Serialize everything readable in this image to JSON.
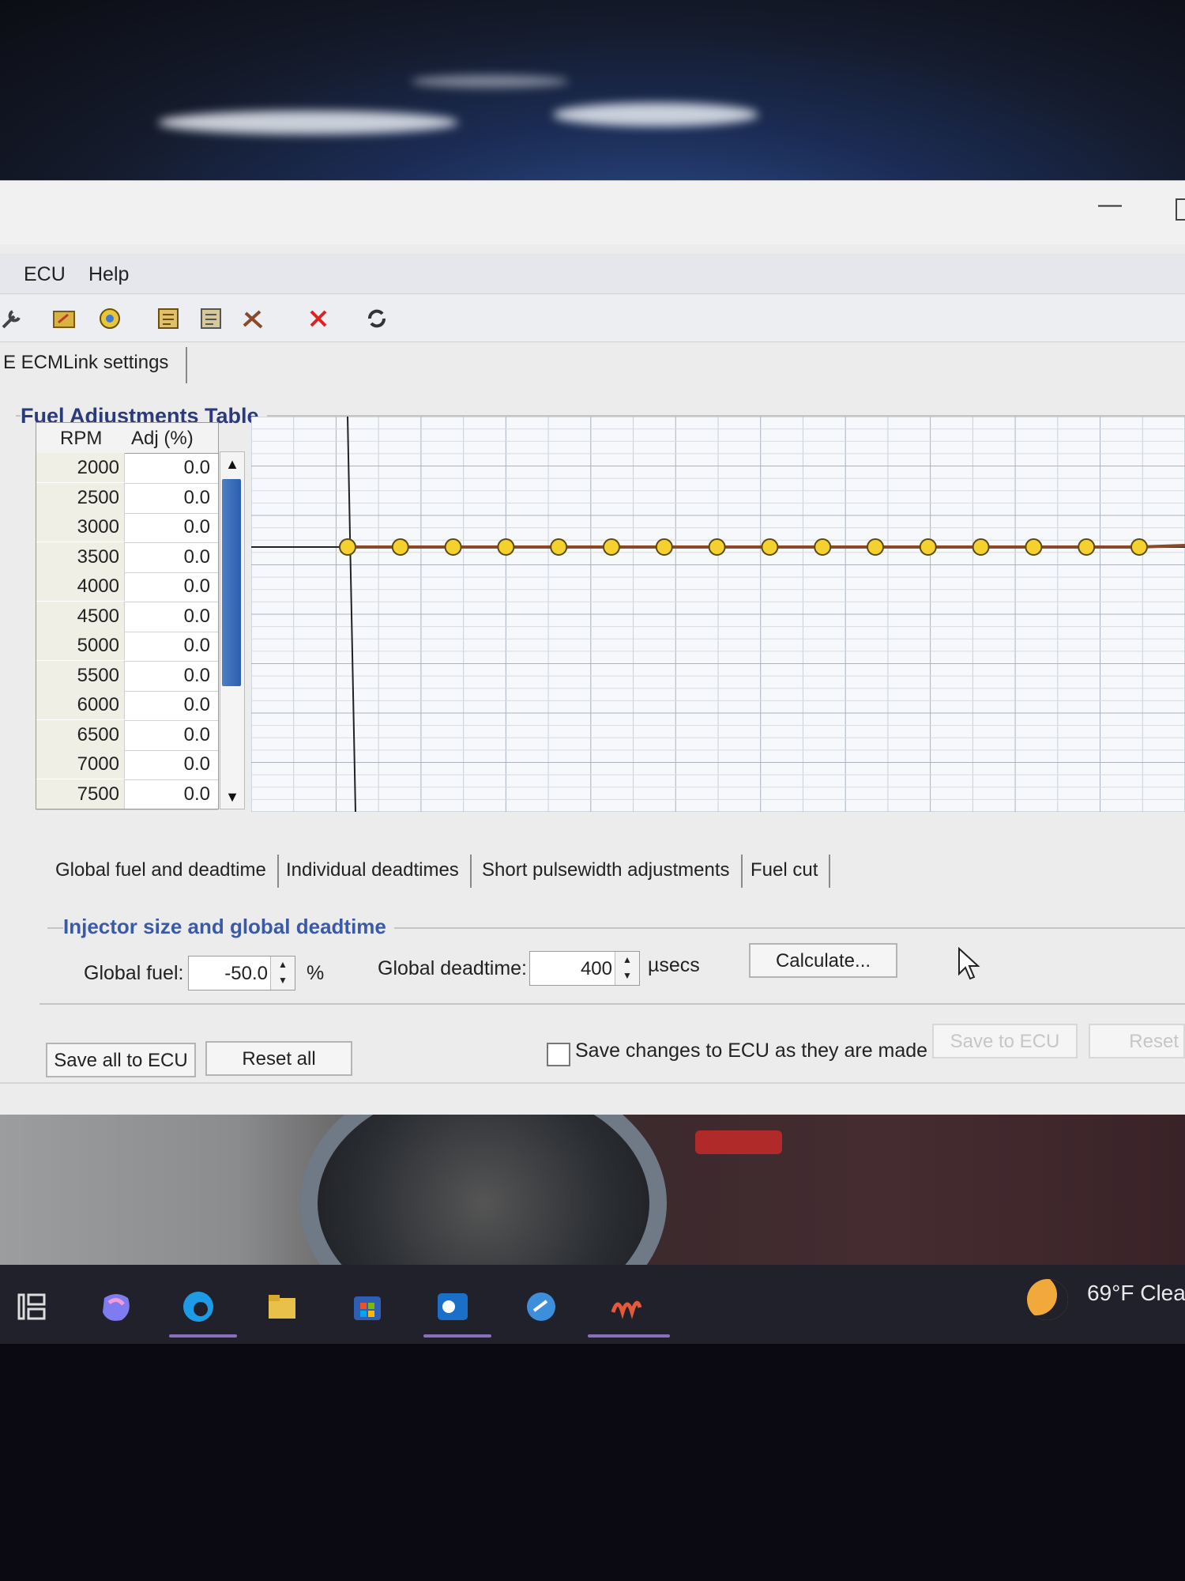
{
  "window": {
    "menu": [
      "ECU",
      "Help"
    ],
    "page_tab": "E ECMLink settings"
  },
  "fuel_table": {
    "title": "Fuel Adjustments Table",
    "columns": [
      "RPM",
      "Adj (%)"
    ],
    "rows": [
      [
        "2000",
        "0.0"
      ],
      [
        "2500",
        "0.0"
      ],
      [
        "3000",
        "0.0"
      ],
      [
        "3500",
        "0.0"
      ],
      [
        "4000",
        "0.0"
      ],
      [
        "4500",
        "0.0"
      ],
      [
        "5000",
        "0.0"
      ],
      [
        "5500",
        "0.0"
      ],
      [
        "6000",
        "0.0"
      ],
      [
        "6500",
        "0.0"
      ],
      [
        "7000",
        "0.0"
      ],
      [
        "7500",
        "0.0"
      ]
    ]
  },
  "chart_data": {
    "type": "line",
    "x": [
      2000,
      2500,
      3000,
      3500,
      4000,
      4500,
      5000,
      5500,
      6000,
      6500,
      7000,
      7500,
      8000,
      8500,
      9000,
      9500
    ],
    "series": [
      {
        "values": [
          0,
          0,
          0,
          0,
          0,
          0,
          0,
          0,
          0,
          0,
          0,
          0,
          0,
          0,
          0,
          0
        ]
      }
    ],
    "grid": true,
    "line_color": "#8a4a2a",
    "marker_color": "#f5d130"
  },
  "sub_tabs": [
    "Global fuel and deadtime",
    "Individual deadtimes",
    "Short pulsewidth adjustments",
    "Fuel cut"
  ],
  "injector": {
    "title": "Injector size and global deadtime",
    "global_fuel_label": "Global fuel:",
    "global_fuel_value": "-50.0",
    "global_fuel_unit": "%",
    "deadtime_label": "Global deadtime:",
    "deadtime_value": "400",
    "deadtime_unit": "µsecs",
    "calculate_label": "Calculate..."
  },
  "actions": {
    "save_all": "Save all to ECU",
    "reset_all": "Reset all",
    "autosave_label": "Save changes to ECU as they are made",
    "save_to_ecu": "Save to ECU",
    "reset": "Reset"
  },
  "taskbar": {
    "weather": "69°F  Clea"
  }
}
